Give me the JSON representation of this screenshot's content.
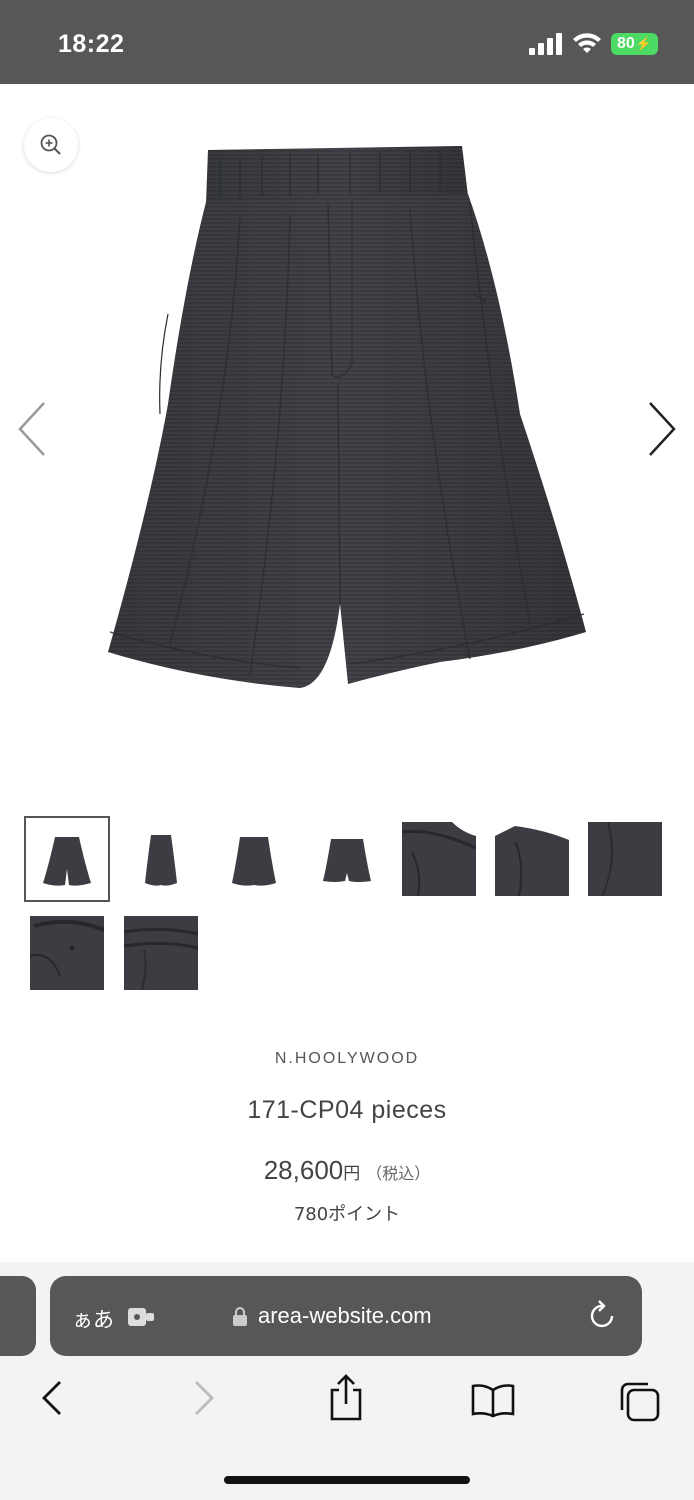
{
  "status_bar": {
    "time": "18:22",
    "battery_level": "80",
    "signal_icon": "cellular-signal-icon",
    "wifi_icon": "wifi-icon"
  },
  "product": {
    "brand": "N.HOOLYWOOD",
    "title": "171-CP04 pieces",
    "price": "28,600",
    "price_currency": "円",
    "price_tax_note": "（税込）",
    "points": "780ポイント",
    "gallery": {
      "thumbnail_count": 9,
      "selected_index": 0,
      "zoom_icon": "zoom-in-icon",
      "prev_icon": "chevron-left-icon",
      "next_icon": "chevron-right-icon"
    }
  },
  "browser": {
    "text_size_label": "ぁあ",
    "url": "area-website.com",
    "icons": [
      "extension-icon",
      "lock-icon",
      "reload-icon",
      "back-icon",
      "forward-icon",
      "share-icon",
      "bookmarks-icon",
      "tabs-icon"
    ]
  },
  "colors": {
    "status_bar_bg": "#575757",
    "address_bar_bg": "#575757",
    "battery_green": "#4cd964",
    "garment": "#3b3d42"
  }
}
